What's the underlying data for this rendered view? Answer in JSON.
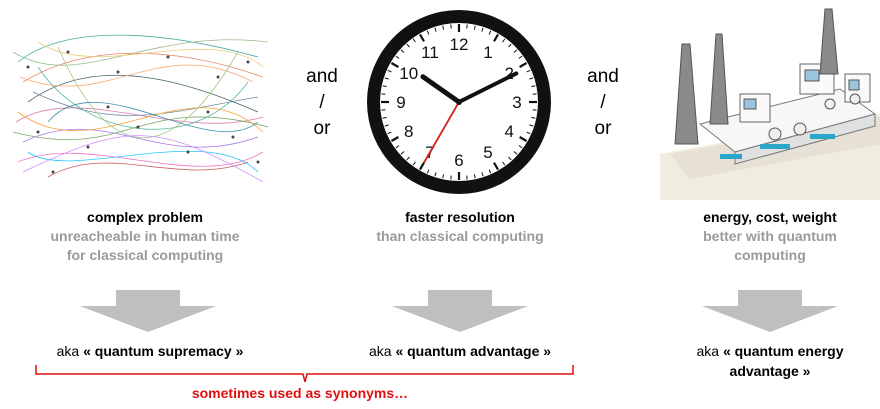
{
  "connectors": [
    {
      "l1": "and",
      "l2": "/",
      "l3": "or"
    },
    {
      "l1": "and",
      "l2": "/",
      "l3": "or"
    }
  ],
  "clock": {
    "numbers": [
      "12",
      "1",
      "2",
      "3",
      "4",
      "5",
      "6",
      "7",
      "8",
      "9",
      "10",
      "11"
    ],
    "time": {
      "hour": 10,
      "minute": 10,
      "second": 35
    }
  },
  "columns": [
    {
      "title": "complex problem",
      "sub1": "unreacheable in human time",
      "sub2": "for classical computing",
      "aka_prefix": "aka ",
      "aka_term": "« quantum supremacy »"
    },
    {
      "title": "faster resolution",
      "sub1": "than classical computing",
      "aka_prefix": "aka ",
      "aka_term": "« quantum advantage »"
    },
    {
      "title": "energy, cost, weight",
      "sub1": "better with quantum",
      "sub2": "computing",
      "aka_prefix": "aka ",
      "aka_term1": "« quantum energy",
      "aka_term2": "advantage »"
    }
  ],
  "footer": "sometimes used as synonyms…",
  "colors": {
    "arrow": "#bfbfbf",
    "brace": "#e01010",
    "accent_text": "#e01010",
    "sub_text": "#9a9a9a"
  }
}
